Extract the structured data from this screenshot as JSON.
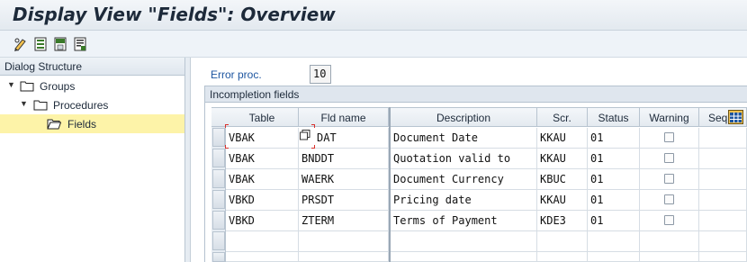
{
  "title": "Display View \"Fields\": Overview",
  "toolbar": {
    "icons": [
      "edit-pencil-icon",
      "document-list-icon",
      "document-save-icon",
      "document-detail-icon"
    ]
  },
  "dialog_structure": {
    "header": "Dialog Structure",
    "items": [
      {
        "label": "Groups",
        "expanded": true
      },
      {
        "label": "Procedures",
        "expanded": true
      },
      {
        "label": "Fields",
        "selected": true
      }
    ]
  },
  "error_proc": {
    "label": "Error proc.",
    "value": "10"
  },
  "incompletion": {
    "title": "Incompletion fields",
    "columns": [
      "Table",
      "Fld name",
      "Description",
      "Scr.",
      "Status",
      "Warning",
      "Seq"
    ],
    "rows": [
      {
        "table": "VBAK",
        "field": "DAT",
        "description": "Document Date",
        "scr": "KKAU",
        "status": "01",
        "warning": false
      },
      {
        "table": "VBAK",
        "field": "BNDDT",
        "description": "Quotation valid to",
        "scr": "KKAU",
        "status": "01",
        "warning": false
      },
      {
        "table": "VBAK",
        "field": "WAERK",
        "description": "Document Currency",
        "scr": "KBUC",
        "status": "01",
        "warning": false
      },
      {
        "table": "VBKD",
        "field": "PRSDT",
        "description": "Pricing date",
        "scr": "KKAU",
        "status": "01",
        "warning": false
      },
      {
        "table": "VBKD",
        "field": "ZTERM",
        "description": "Terms of Payment",
        "scr": "KDE3",
        "status": "01",
        "warning": false
      }
    ]
  },
  "colors": {
    "selected_row": "#fdf3a8",
    "label_blue": "#1e56a0"
  }
}
